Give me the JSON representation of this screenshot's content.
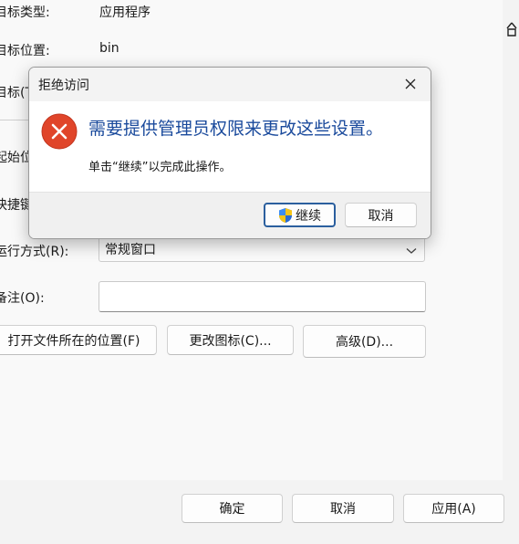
{
  "properties": {
    "rows": [
      {
        "label": "目标类型:",
        "value": "应用程序"
      },
      {
        "label": "目标位置:",
        "value": "bin"
      },
      {
        "label": "目标(T)",
        "value": ""
      },
      {
        "label": "起始位",
        "value": ""
      },
      {
        "label": "快捷键",
        "value": ""
      }
    ],
    "run_label": "运行方式(R):",
    "run_value": "常规窗口",
    "comment_label": "备注(O):",
    "comment_value": "",
    "btn_open_location": "打开文件所在的位置(F)",
    "btn_change_icon": "更改图标(C)...",
    "btn_advanced": "高级(D)..."
  },
  "footer": {
    "ok": "确定",
    "cancel": "取消",
    "apply": "应用(A)"
  },
  "dialog": {
    "title": "拒绝访问",
    "heading": "需要提供管理员权限来更改这些设置。",
    "message": "单击“继续”以完成此操作。",
    "continue_label": "继续",
    "cancel_label": "取消"
  },
  "colors": {
    "heading": "#1a4a9c",
    "error_red": "#e0452a",
    "focus_border": "#2b5f9e"
  }
}
